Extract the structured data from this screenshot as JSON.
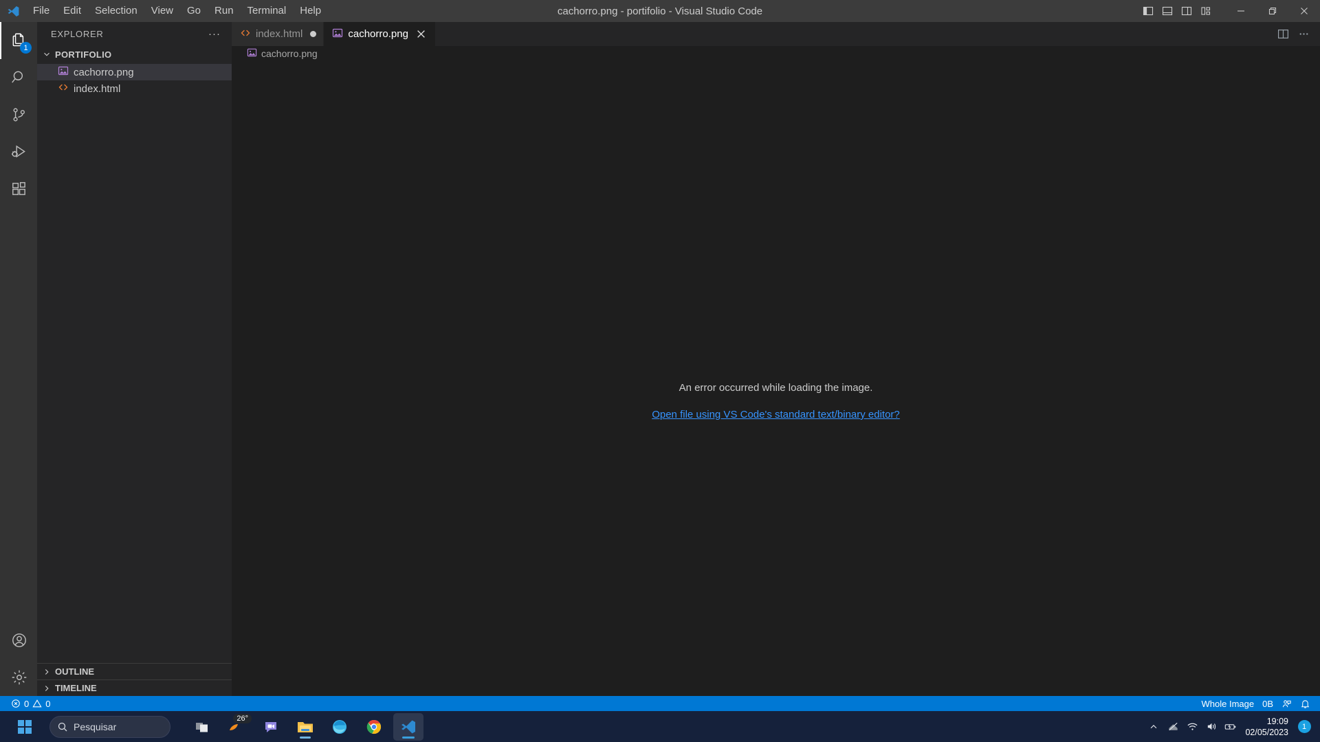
{
  "titlebar": {
    "title": "cachorro.png - portifolio - Visual Studio Code",
    "menu": [
      "File",
      "Edit",
      "Selection",
      "View",
      "Go",
      "Run",
      "Terminal",
      "Help"
    ],
    "layout_buttons": [
      "toggle-primary-sidebar",
      "toggle-panel",
      "toggle-secondary-sidebar",
      "customize-layout"
    ],
    "window_buttons": [
      "minimize",
      "restore",
      "close"
    ]
  },
  "activitybar": {
    "items": [
      {
        "name": "explorer",
        "badge": "1",
        "active": true
      },
      {
        "name": "search",
        "badge": "",
        "active": false
      },
      {
        "name": "source-control",
        "badge": "",
        "active": false
      },
      {
        "name": "run-and-debug",
        "badge": "",
        "active": false
      },
      {
        "name": "extensions",
        "badge": "",
        "active": false
      }
    ],
    "bottom_items": [
      {
        "name": "accounts"
      },
      {
        "name": "manage-settings"
      }
    ]
  },
  "sidebar": {
    "title": "EXPLORER",
    "more_actions": "···",
    "folder": "PORTIFOLIO",
    "files": [
      {
        "name": "cachorro.png",
        "icon": "image-file-icon",
        "selected": true
      },
      {
        "name": "index.html",
        "icon": "html-file-icon",
        "selected": false
      }
    ],
    "panels": [
      "OUTLINE",
      "TIMELINE"
    ]
  },
  "editor": {
    "tabs": [
      {
        "label": "index.html",
        "icon": "html-file-icon",
        "active": false,
        "dirty": true
      },
      {
        "label": "cachorro.png",
        "icon": "image-file-icon",
        "active": true,
        "dirty": false
      }
    ],
    "breadcrumb": "cachorro.png",
    "breadcrumb_icon": "image-file-icon",
    "error_message": "An error occurred while loading the image.",
    "error_link": "Open file using VS Code's standard text/binary editor?",
    "actions": [
      "split-editor",
      "more-actions"
    ]
  },
  "statusbar": {
    "errors": "0",
    "warnings": "0",
    "image_size_label": "Whole Image",
    "file_size": "0B",
    "accent": "#0078d4",
    "right_icons": [
      "remote-feedback-icon",
      "notifications-bell-icon"
    ]
  },
  "taskbar": {
    "search_placeholder": "Pesquisar",
    "weather_temp": "26°",
    "apps": [
      {
        "name": "task-view",
        "running": false
      },
      {
        "name": "weather",
        "running": false
      },
      {
        "name": "chat",
        "running": false
      },
      {
        "name": "file-explorer",
        "running": true
      },
      {
        "name": "microsoft-edge",
        "running": false
      },
      {
        "name": "google-chrome",
        "running": true
      },
      {
        "name": "visual-studio-code",
        "running": true,
        "active": true
      }
    ],
    "tray_icons": [
      "show-hidden-icons-chevron",
      "network-disconnected-icon",
      "wifi-icon",
      "volume-icon",
      "battery-charging-icon"
    ],
    "time": "19:09",
    "date": "02/05/2023",
    "notification_count": "1"
  }
}
